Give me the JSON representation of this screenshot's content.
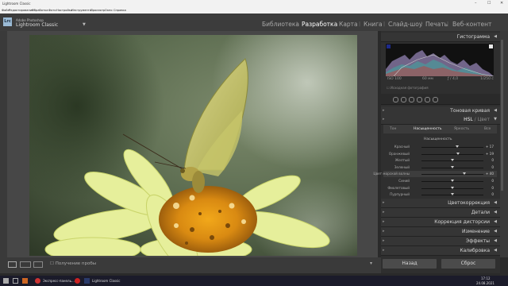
{
  "window": {
    "title": "Lightroom Classic",
    "controls": [
      "–",
      "☐",
      "✕"
    ]
  },
  "menubar": {
    "items": [
      "Файл",
      "Редактирование",
      "Обработка",
      "Фото",
      "Настройки",
      "Инструменты",
      "Просмотр",
      "Окно",
      "Справка"
    ]
  },
  "identity": {
    "logo": "Lrc",
    "brand_line1": "Adobe Photoshop",
    "brand_line2": "Lightroom Classic",
    "dropdown": "▼"
  },
  "modules": {
    "items": [
      "Библиотека",
      "Разработка",
      "Карта",
      "Книга",
      "Слайд-шоу",
      "Печать",
      "Веб-контент"
    ],
    "active_index": 1
  },
  "panels": {
    "histogram": "Гистограмма",
    "histogram_info": [
      "ISO 100",
      "60 мм",
      "ƒ / 4,0",
      "1/250 с"
    ],
    "original_photo": "Исходная фотография",
    "tone_curve": "Тоновая кривая",
    "hsl_title": "HSL",
    "hsl_sep": "/",
    "hsl_color": "Цвет",
    "hsl_tabs": [
      "Тон",
      "Насыщенность",
      "Яркость",
      "Все"
    ],
    "hsl_active_tab": 1,
    "saturation_label": "Насыщенность",
    "color_grading": "Цветокоррекция",
    "detail": "Детали",
    "lens": "Коррекция дисторсии",
    "transform": "Изменение",
    "effects": "Эффекты",
    "calibration": "Калибровка"
  },
  "sliders": [
    {
      "name": "Красный",
      "value": "+ 17",
      "level": 0.585
    },
    {
      "name": "Оранжевый",
      "value": "+ 19",
      "level": 0.595
    },
    {
      "name": "Желтый",
      "value": "0",
      "level": 0.5
    },
    {
      "name": "Зеленый",
      "value": "0",
      "level": 0.5
    },
    {
      "name": "Цвет морской волны",
      "value": "+ 40",
      "level": 0.7
    },
    {
      "name": "Синий",
      "value": "0",
      "level": 0.5
    },
    {
      "name": "Фиолетовый",
      "value": "0",
      "level": 0.5
    },
    {
      "name": "Пурпурный",
      "value": "0",
      "level": 0.5
    }
  ],
  "highlight_slider_index": 4,
  "bottom": {
    "soft_proof": "Получение пробы",
    "prev_button": "Назад",
    "reset_button": "Сброс"
  },
  "taskbar": {
    "item1": "Экспресс-панель...",
    "item2": "Lightroom Classic",
    "time": "17:12",
    "date": "24.08.2021"
  },
  "colors": {
    "accent_active": "#ffffff",
    "panel_bg": "#2f2f2f",
    "taskbar_bg": "#1b1b2a"
  }
}
